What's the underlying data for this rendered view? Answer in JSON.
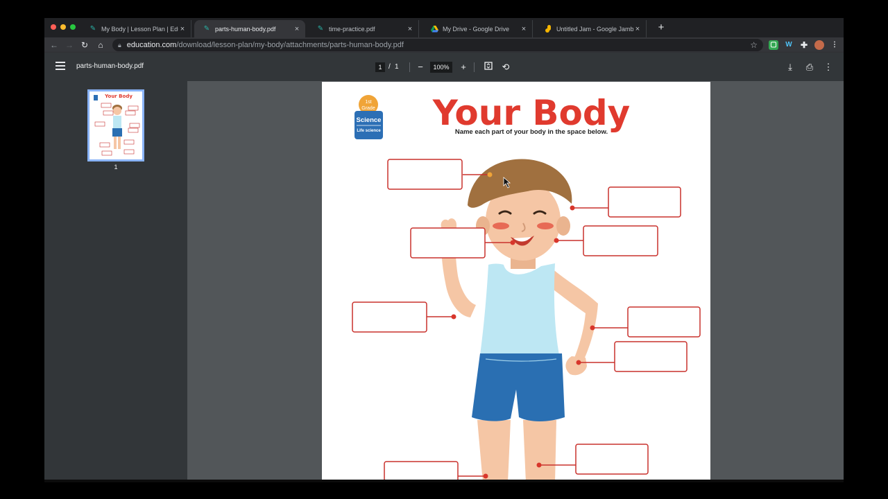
{
  "browser": {
    "tabs": [
      {
        "label": "My Body | Lesson Plan | Educa",
        "icon": "education-icon"
      },
      {
        "label": "parts-human-body.pdf",
        "icon": "education-icon",
        "active": true
      },
      {
        "label": "time-practice.pdf",
        "icon": "education-icon"
      },
      {
        "label": "My Drive - Google Drive",
        "icon": "google-drive-icon"
      },
      {
        "label": "Untitled Jam - Google Jamboa",
        "icon": "jamboard-icon"
      }
    ],
    "address": {
      "host": "education.com",
      "path": "/download/lesson-plan/my-body/attachments/parts-human-body.pdf"
    },
    "extensions": [
      "extension-green-icon",
      "extension-w-icon",
      "puzzle-icon",
      "profile-avatar"
    ]
  },
  "pdf_viewer": {
    "title": "parts-human-body.pdf",
    "current_page": "1",
    "page_separator": "/",
    "total_pages": "1",
    "zoom": "100%",
    "thumbnail_label": "1"
  },
  "worksheet": {
    "title": "Your Body",
    "subtitle": "Name each part of your body in the space below.",
    "grade_badge": "1st Grade",
    "grade_line1": "1st",
    "grade_line2": "Grade",
    "subject": "Science",
    "subject_sub": "Life science",
    "thumb_title": "Your Body",
    "blank_label_boxes": 11
  },
  "colors": {
    "title_red": "#e03a2e",
    "box_red": "#c9302c",
    "science_blue": "#2c6fb5",
    "grade_orange": "#f0a437",
    "shirt": "#bde7f3",
    "shorts": "#2a6fb2",
    "skin": "#f5c6a5",
    "hair": "#a0703f"
  }
}
